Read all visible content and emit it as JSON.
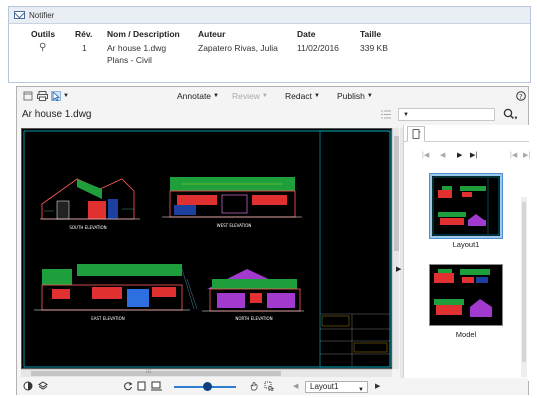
{
  "notifier": {
    "title": "Notifier",
    "headers": {
      "tools": "Outils",
      "rev": "Rév.",
      "name": "Nom / Description",
      "author": "Auteur",
      "date": "Date",
      "size": "Taille"
    },
    "row": {
      "rev": "1",
      "name": "Ar house 1.dwg",
      "description": "Plans - Civil",
      "author": "Zapatero Rivas, Julia",
      "date": "11/02/2016",
      "size": "339 KB"
    }
  },
  "toolbar": {
    "annotate": "Annotate",
    "review": "Review",
    "redact": "Redact",
    "publish": "Publish"
  },
  "document": {
    "name": "Ar house 1.dwg"
  },
  "drawing": {
    "labels": [
      "SOUTH ELEVATION",
      "WEST ELEVATION",
      "EAST ELEVATION",
      "NORTH ELEVATION"
    ]
  },
  "panel": {
    "pages": [
      {
        "label": "Layout1",
        "selected": true
      },
      {
        "label": "Model",
        "selected": false
      }
    ]
  },
  "bottombar": {
    "layout_select": "Layout1"
  },
  "colors": {
    "accent": "#2f7fd0",
    "selected_thumb": "#9cc8ee",
    "canvas_bg": "#000000"
  }
}
